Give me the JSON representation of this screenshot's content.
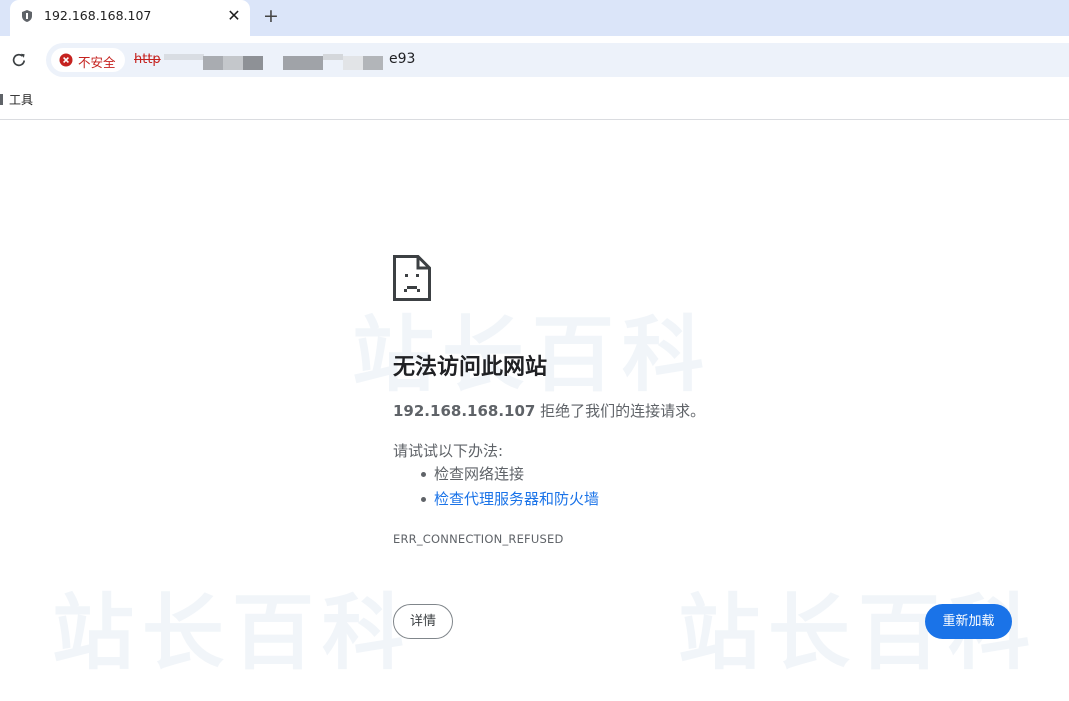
{
  "tab": {
    "title": "192.168.168.107",
    "close_glyph": "✕",
    "new_tab_glyph": "+",
    "favicon": "shield-icon"
  },
  "toolbar": {
    "reload_icon": "reload-icon",
    "security_label": "不安全",
    "security_icon": "warning-icon",
    "security_color": "#c5221f",
    "url_scheme": "http",
    "url_tail": "e93"
  },
  "bookmarks": {
    "items": [
      {
        "label": "工具"
      }
    ]
  },
  "watermark": {
    "text": "站长百科"
  },
  "error_page": {
    "icon": "sad-page-icon",
    "heading": "无法访问此网站",
    "host": "192.168.168.107",
    "description_suffix": " 拒绝了我们的连接请求。",
    "try_label": "请试试以下办法:",
    "suggestions": [
      {
        "text": "检查网络连接",
        "is_link": false
      },
      {
        "text": "检查代理服务器和防火墙",
        "is_link": true
      }
    ],
    "error_code": "ERR_CONNECTION_REFUSED",
    "details_button": "详情",
    "reload_button": "重新加载",
    "accent_color": "#1a73e8"
  }
}
